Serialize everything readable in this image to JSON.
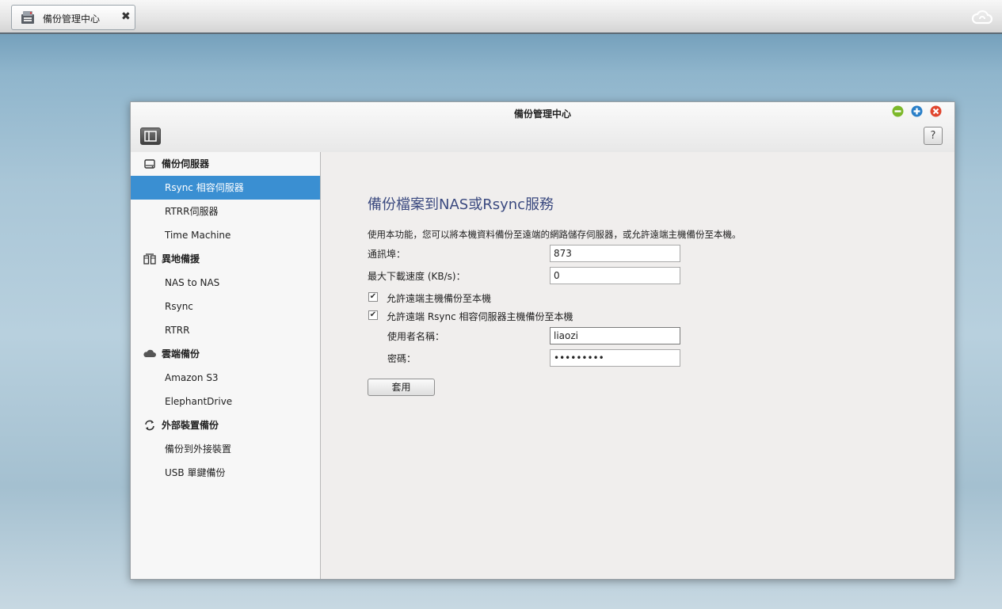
{
  "taskbar": {
    "tab_label": "備份管理中心",
    "close_glyph": "✖"
  },
  "window": {
    "title": "備份管理中心",
    "controls": {
      "minimize_color": "#7cb82a",
      "maximize_color": "#2a7fc8",
      "close_color": "#e0462f"
    },
    "help_glyph": "?"
  },
  "sidebar": {
    "groups": [
      {
        "label": "備份伺服器",
        "icon": "server-icon",
        "items": [
          {
            "label": "Rsync 相容伺服器",
            "active": true
          },
          {
            "label": "RTRR伺服器"
          },
          {
            "label": "Time Machine"
          }
        ]
      },
      {
        "label": "異地備援",
        "icon": "remote-backup-icon",
        "items": [
          {
            "label": "NAS to NAS"
          },
          {
            "label": "Rsync"
          },
          {
            "label": "RTRR"
          }
        ]
      },
      {
        "label": "雲端備份",
        "icon": "cloud-icon",
        "items": [
          {
            "label": "Amazon S3"
          },
          {
            "label": "ElephantDrive"
          }
        ]
      },
      {
        "label": "外部裝置備份",
        "icon": "sync-arrows-icon",
        "items": [
          {
            "label": "備份到外接裝置"
          },
          {
            "label": "USB 單鍵備份"
          }
        ]
      }
    ]
  },
  "main": {
    "heading": "備份檔案到NAS或Rsync服務",
    "description": "使用本功能，您可以將本機資料備份至遠端的網路儲存伺服器，或允許遠端主機備份至本機。",
    "port_label": "通訊埠：",
    "port_value": "873",
    "speed_label": "最大下載速度 (KB/s)：",
    "speed_value": "0",
    "allow_remote_label": "允許遠端主機備份至本機",
    "allow_rsync_label": "允許遠端 Rsync 相容伺服器主機備份至本機",
    "allow_remote_checked": true,
    "allow_rsync_checked": true,
    "check_glyph": "✔",
    "username_label": "使用者名稱：",
    "username_value": "liaozi",
    "password_label": "密碼：",
    "password_value": "•••••••••",
    "apply_label": "套用"
  },
  "colors": {
    "active_item": "#3a8fd2",
    "heading": "#3b4a80"
  }
}
